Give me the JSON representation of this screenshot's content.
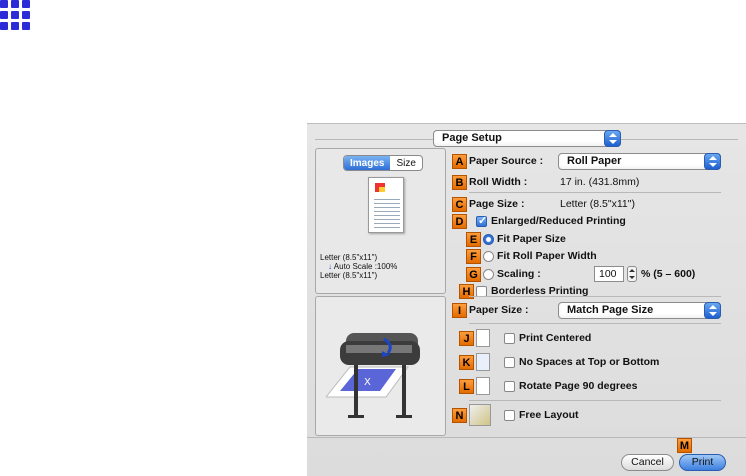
{
  "dialog": {
    "setup_popup": "Page Setup",
    "tabs": [
      "Images",
      "Size"
    ],
    "selected_tab": "Images",
    "preview_text": [
      "Letter (8.5\"x11\")",
      "Auto Scale :100%",
      "Letter (8.5\"x11\")"
    ],
    "rows": {
      "A": {
        "label": "Paper Source :",
        "value": "Roll Paper"
      },
      "B": {
        "label": "Roll Width :",
        "value": "17 in. (431.8mm)"
      },
      "C": {
        "label": "Page Size :",
        "value": "Letter (8.5\"x11\")"
      },
      "D": {
        "label": "Enlarged/Reduced Printing",
        "checked": true
      },
      "E": {
        "label": "Fit Paper Size",
        "selected": true
      },
      "F": {
        "label": "Fit Roll Paper Width",
        "selected": false
      },
      "G": {
        "label": "Scaling :",
        "value": "100",
        "range": "% (5 – 600)",
        "selected": false
      },
      "H": {
        "label": "Borderless Printing",
        "checked": false
      },
      "I": {
        "label": "Paper Size :",
        "value": "Match Page Size"
      },
      "J": {
        "label": "Print Centered",
        "checked": false
      },
      "K": {
        "label": "No Spaces at Top or Bottom",
        "checked": false
      },
      "L": {
        "label": "Rotate Page 90 degrees",
        "checked": false
      },
      "N": {
        "label": "Free Layout",
        "checked": false
      }
    },
    "tag_letters": {
      "A": "A",
      "B": "B",
      "C": "C",
      "D": "D",
      "E": "E",
      "F": "F",
      "G": "G",
      "H": "H",
      "I": "I",
      "J": "J",
      "K": "K",
      "L": "L",
      "M": "M",
      "N": "N"
    },
    "cancel_label": "Cancel",
    "print_label": "Print"
  },
  "colors": {
    "logo_blue": "#2b2bd8",
    "tag_orange": "#f08a1c",
    "accent_blue": "#2f6fd6"
  }
}
